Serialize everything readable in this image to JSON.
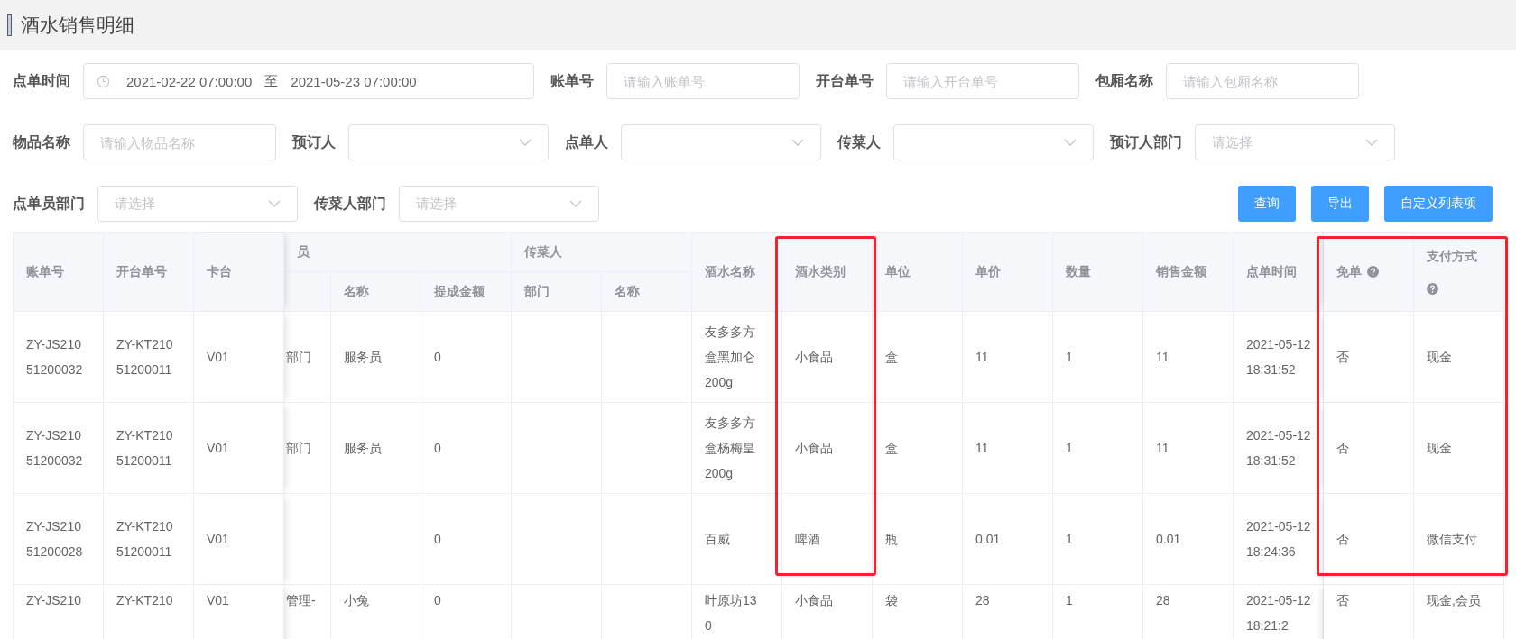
{
  "page": {
    "title": "酒水销售明细"
  },
  "filter_rows": [
    [
      {
        "kind": "daterange",
        "label": "点单时间",
        "start": "2021-02-22 07:00:00",
        "separator": "至",
        "end": "2021-05-23 07:00:00"
      },
      {
        "kind": "input",
        "label": "账单号",
        "placeholder": "请输入账单号"
      },
      {
        "kind": "input",
        "label": "开台单号",
        "placeholder": "请输入开台单号"
      },
      {
        "kind": "input",
        "label": "包厢名称",
        "placeholder": "请输入包厢名称"
      }
    ],
    [
      {
        "kind": "input",
        "label": "物品名称",
        "placeholder": "请输入物品名称"
      },
      {
        "kind": "select",
        "label": "预订人"
      },
      {
        "kind": "select",
        "label": "点单人"
      },
      {
        "kind": "select",
        "label": "传菜人"
      },
      {
        "kind": "select",
        "label": "预订人部门",
        "placeholder": "请选择"
      }
    ],
    [
      {
        "kind": "select",
        "label": "点单员部门",
        "placeholder": "请选择"
      },
      {
        "kind": "select",
        "label": "传菜人部门",
        "placeholder": "请选择"
      }
    ]
  ],
  "buttons": [
    "查询",
    "导出",
    "自定义列表项"
  ],
  "table": {
    "columns": [
      {
        "label": "账单号",
        "fixed": true
      },
      {
        "label": "开台单号",
        "fixed": true
      },
      {
        "label": "卡台",
        "fixed": true
      },
      {
        "grouped": true,
        "group": {
          "label": "员"
        }
      },
      {
        "grouped": true,
        "label": "名称"
      },
      {
        "grouped": true,
        "label": "提成金额"
      },
      {
        "grouped": true,
        "group": {
          "label": "传菜人"
        },
        "label": "部门"
      },
      {
        "grouped": true,
        "label": "名称"
      },
      {
        "label": "酒水名称"
      },
      {
        "label": "酒水类别",
        "framed": true
      },
      {
        "label": "单位"
      },
      {
        "label": "单价"
      },
      {
        "label": "数量"
      },
      {
        "label": "销售金额"
      },
      {
        "label": "点单时间"
      },
      {
        "label": "免单",
        "help": true,
        "fixed": true,
        "framed": true
      },
      {
        "label": "支付方式",
        "help": true,
        "fixed": true,
        "framed": true
      }
    ],
    "rows": [
      {
        "framed": true,
        "cells": [
          "ZY-JS21051200032",
          "ZY-KT21051200011",
          "V01",
          "部门",
          "服务员",
          "0",
          null,
          null,
          "友多多方盒黑加仑200g",
          "小食品",
          "盒",
          "11",
          "1",
          "11",
          "2021-05-12 18:31:52",
          "否",
          "现金"
        ]
      },
      {
        "framed": true,
        "cells": [
          "ZY-JS21051200032",
          "ZY-KT21051200011",
          "V01",
          "部门",
          "服务员",
          "0",
          null,
          null,
          "友多多方盒杨梅皇200g",
          "小食品",
          "盒",
          "11",
          "1",
          "11",
          "2021-05-12 18:31:52",
          "否",
          "现金"
        ]
      },
      {
        "framed": true,
        "cells": [
          "ZY-JS21051200028",
          "ZY-KT21051200011",
          "V01",
          null,
          null,
          "0",
          null,
          null,
          "百威",
          "啤酒",
          "瓶",
          "0.01",
          "1",
          "0.01",
          "2021-05-12 18:24:36",
          "否",
          "微信支付"
        ]
      },
      {
        "framed": false,
        "cells": [
          "ZY-JS210",
          "ZY-KT210",
          "V01",
          "管理-",
          "小兔",
          "0",
          null,
          null,
          "叶原坊130",
          "小食品",
          "袋",
          "28",
          "1",
          "28",
          "2021-05-12 18:21:2",
          "否",
          "现金,会员"
        ]
      }
    ]
  }
}
